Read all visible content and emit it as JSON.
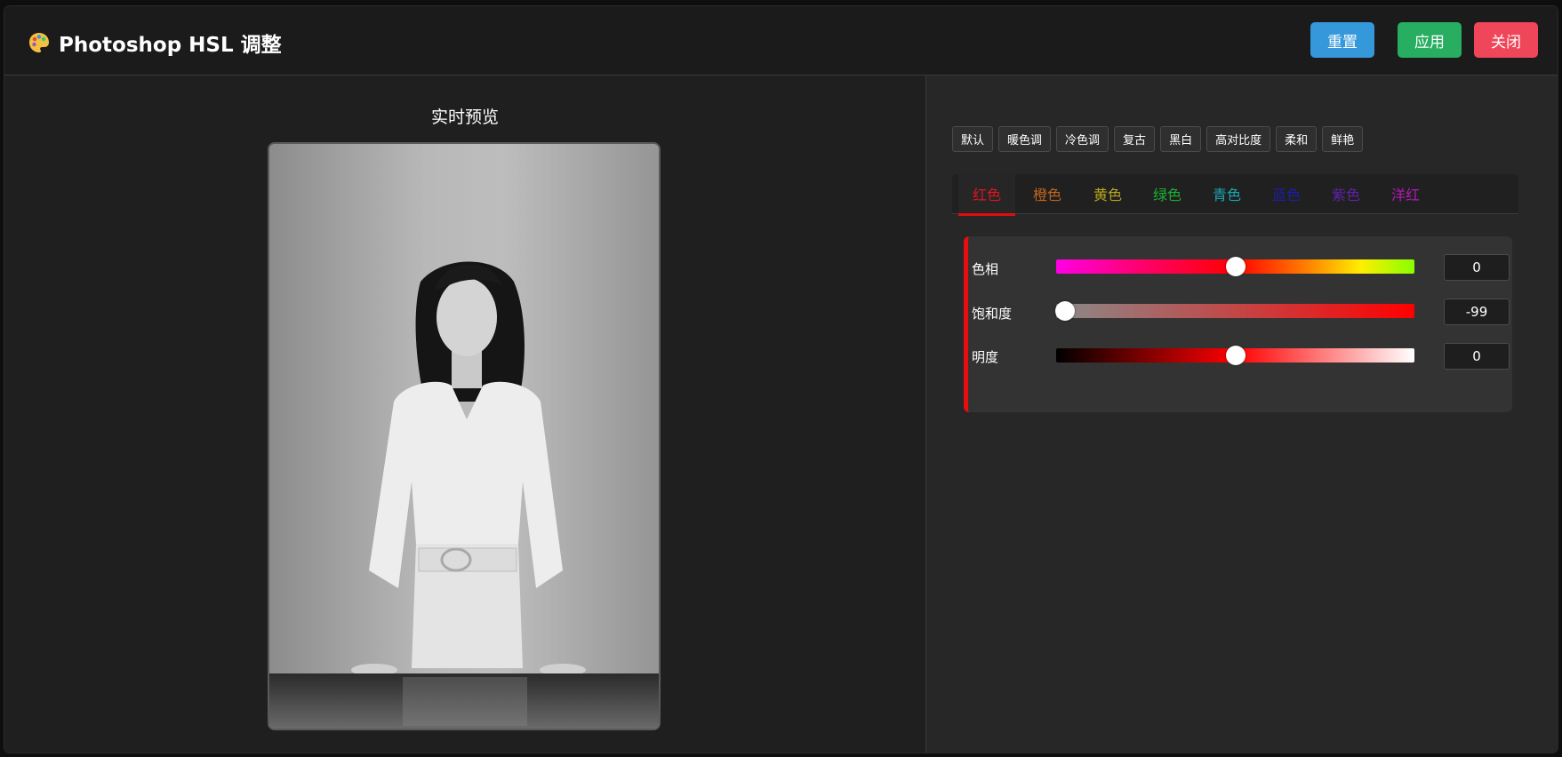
{
  "header": {
    "title": "Photoshop HSL 调整",
    "reset_label": "重置",
    "apply_label": "应用",
    "close_label": "关闭"
  },
  "preview": {
    "title": "实时预览"
  },
  "presets": [
    "默认",
    "暖色调",
    "冷色调",
    "复古",
    "黑白",
    "高对比度",
    "柔和",
    "鲜艳"
  ],
  "tabs": [
    {
      "label": "红色",
      "color": "#e0141e",
      "active": true
    },
    {
      "label": "橙色",
      "color": "#c0651c"
    },
    {
      "label": "黄色",
      "color": "#b8a61a"
    },
    {
      "label": "绿色",
      "color": "#18b030"
    },
    {
      "label": "青色",
      "color": "#1aa7b0"
    },
    {
      "label": "蓝色",
      "color": "#1d1ea5"
    },
    {
      "label": "紫色",
      "color": "#5d23a8"
    },
    {
      "label": "洋红",
      "color": "#b01ab8"
    }
  ],
  "adjustments": {
    "hue": {
      "label": "色相",
      "value": "0",
      "fraction": 0.5
    },
    "saturation": {
      "label": "饱和度",
      "value": "-99",
      "fraction": 0.025
    },
    "lightness": {
      "label": "明度",
      "value": "0",
      "fraction": 0.5
    }
  },
  "colors": {
    "accent_red": "#e60e0e",
    "reset_blue": "#3498db",
    "apply_green": "#27ae60",
    "close_red": "#f0465a"
  }
}
